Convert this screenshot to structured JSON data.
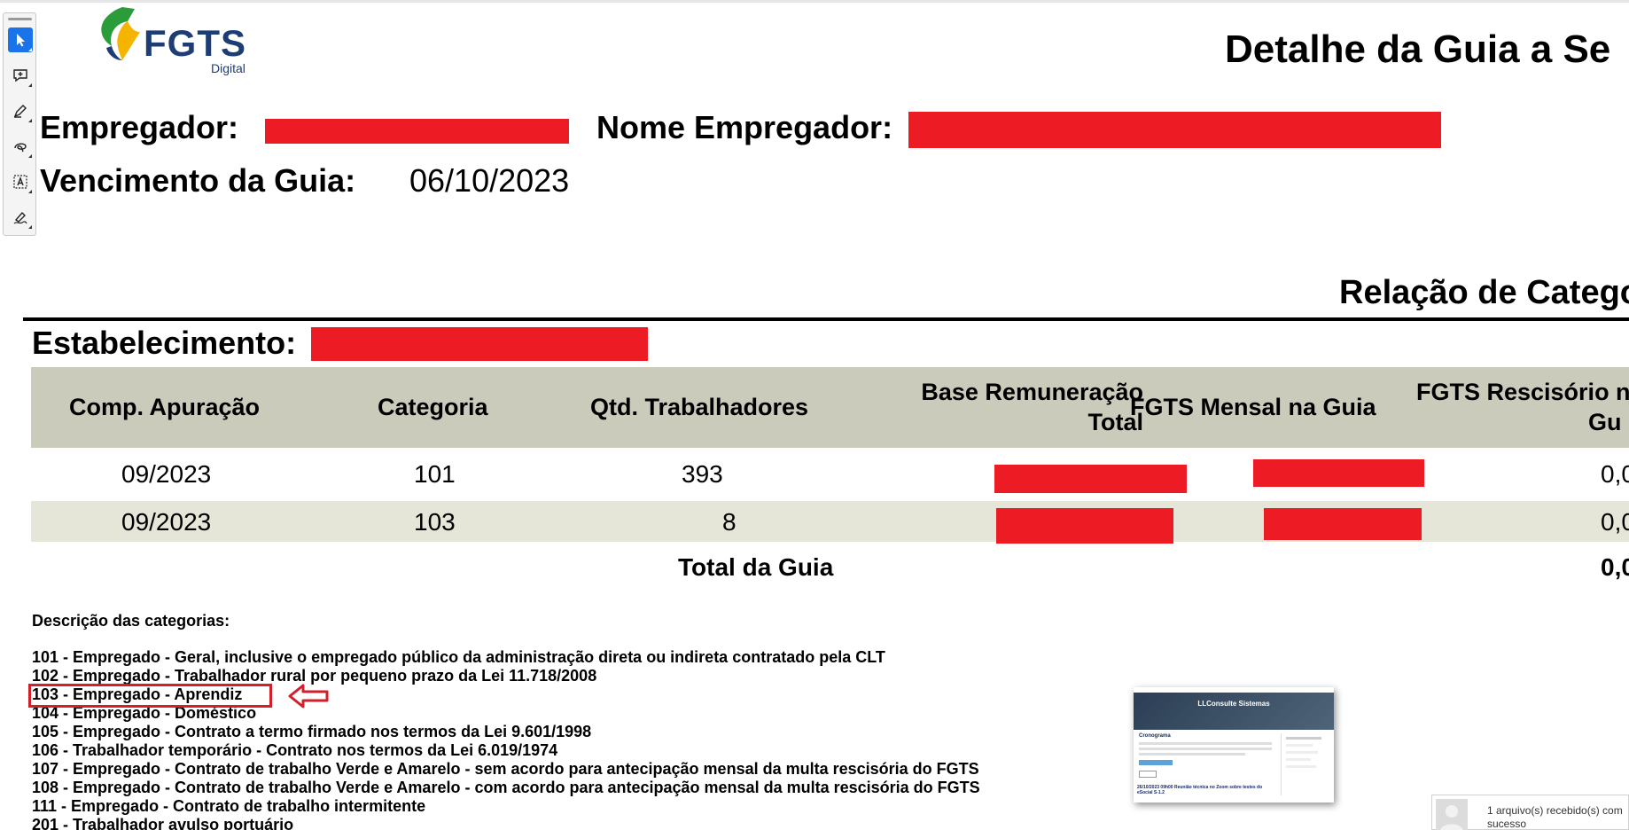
{
  "header": {
    "logo_text": "FGTS",
    "logo_sub": "Digital",
    "title": "Detalhe da Guia a Se"
  },
  "employer": {
    "empregador_label": "Empregador:",
    "nome_label": "Nome Empregador:",
    "vencimento_label": "Vencimento da Guia:",
    "vencimento_value": "06/10/2023"
  },
  "section": {
    "title": "Relação de Catego",
    "estabelecimento_label": "Estabelecimento:"
  },
  "table": {
    "columns": [
      "Comp. Apuração",
      "Categoria",
      "Qtd. Trabalhadores",
      "Base Remuneração",
      "Total",
      "FGTS Mensal na Guia",
      "FGTS Rescisório n",
      "Gu"
    ],
    "rows": [
      {
        "comp": "09/2023",
        "categoria": "101",
        "qtd": "393",
        "rescisorio": "0,0"
      },
      {
        "comp": "09/2023",
        "categoria": "103",
        "qtd": "8",
        "rescisorio": "0,0"
      }
    ],
    "total_label": "Total da Guia",
    "total_rescisorio": "0,0"
  },
  "descricao": {
    "title": "Descrição das categorias:",
    "items": [
      "101 - Empregado - Geral, inclusive o empregado público da administração direta ou indireta contratado pela CLT",
      "102 - Empregado - Trabalhador rural por pequeno prazo da Lei 11.718/2008",
      "103 - Empregado - Aprendiz",
      "104 - Empregado - Doméstico",
      "105 - Empregado - Contrato a termo firmado nos termos da Lei 9.601/1998",
      "106 - Trabalhador temporário - Contrato nos termos da Lei 6.019/1974",
      "107 - Empregado - Contrato de trabalho Verde e Amarelo - sem acordo para antecipação mensal da multa rescisória do FGTS",
      "108 - Empregado - Contrato de trabalho Verde e Amarelo - com acordo para antecipação mensal da multa rescisória do FGTS",
      "111 - Empregado - Contrato de trabalho intermitente",
      "201 - Trabalhador avulso portuário"
    ]
  },
  "thumbnail": {
    "title": "LLConsulte Sistemas",
    "heading": "Cronograma",
    "caption": "26/10/2023 09h00 Reunião técnica no Zoom sobre testes do eSocial S-1.2"
  },
  "toast": {
    "message": "1 arquivo(s) recebido(s) com sucesso"
  },
  "colors": {
    "redaction": "#ed1c24",
    "table_header": "#cbcbbb",
    "row_alt": "#e5e6d8",
    "brand": "#1d3d74",
    "annotation": "#d1202b",
    "tool_active": "#1a73e8"
  }
}
